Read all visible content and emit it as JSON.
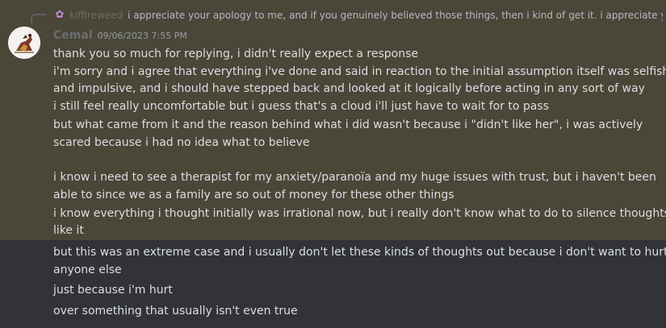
{
  "reply": {
    "name": "kiffireweed",
    "text": "i appreciate your apology to me, and if you genuinely believed those things, then i kind of get it. i appreciate y"
  },
  "author": {
    "name": "Cemal",
    "timestamp": "09/06/2023 7:55 PM"
  },
  "colors": {
    "highlight": "#4a4638",
    "background": "#313338",
    "text": "#dbdee1"
  },
  "lines": [
    "thank you so much for replying, i didn't really expect a response",
    "i'm sorry and i agree that everything i've done and said in reaction to the initial assumption itself was selfish",
    "and impulsive, and i should have stepped back and looked at it logically before acting in any sort of way",
    "i still feel really uncomfortable but i guess that's a cloud i'll just have to wait for to pass",
    "but what came from it and the reason behind what i did wasn't because i \"didn't like her\", i was actively",
    "scared because i had no idea what to believe",
    "i know i need to see a therapist for my anxiety/paranoïa and my huge issues with trust, but i haven't been",
    "able to since we as a family are so out of money for these other things",
    "i know everything i thought initially was irrational now, but i really don't know what to do to silence thoughts",
    "like it",
    "but this was an extreme case and i usually don't let these kinds of thoughts out because i don't want to hurt",
    "anyone else",
    "just because i'm hurt",
    "over something that usually isn't even true"
  ]
}
